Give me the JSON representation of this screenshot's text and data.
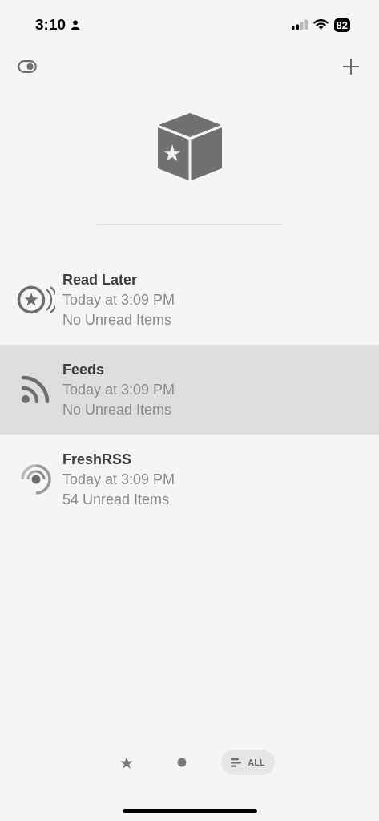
{
  "status_bar": {
    "time": "3:10",
    "battery": "82"
  },
  "accounts": [
    {
      "kind": "read_later",
      "name": "Read Later",
      "updated": "Today at 3:09 PM",
      "unread": "No Unread Items",
      "selected": false
    },
    {
      "kind": "feeds",
      "name": "Feeds",
      "updated": "Today at 3:09 PM",
      "unread": "No Unread Items",
      "selected": true
    },
    {
      "kind": "freshrss",
      "name": "FreshRSS",
      "updated": "Today at 3:09 PM",
      "unread": "54 Unread Items",
      "selected": false
    }
  ],
  "filters": [
    {
      "kind": "starred",
      "selected": false
    },
    {
      "kind": "unread",
      "selected": false
    },
    {
      "kind": "all",
      "label": "ALL",
      "selected": true
    }
  ]
}
